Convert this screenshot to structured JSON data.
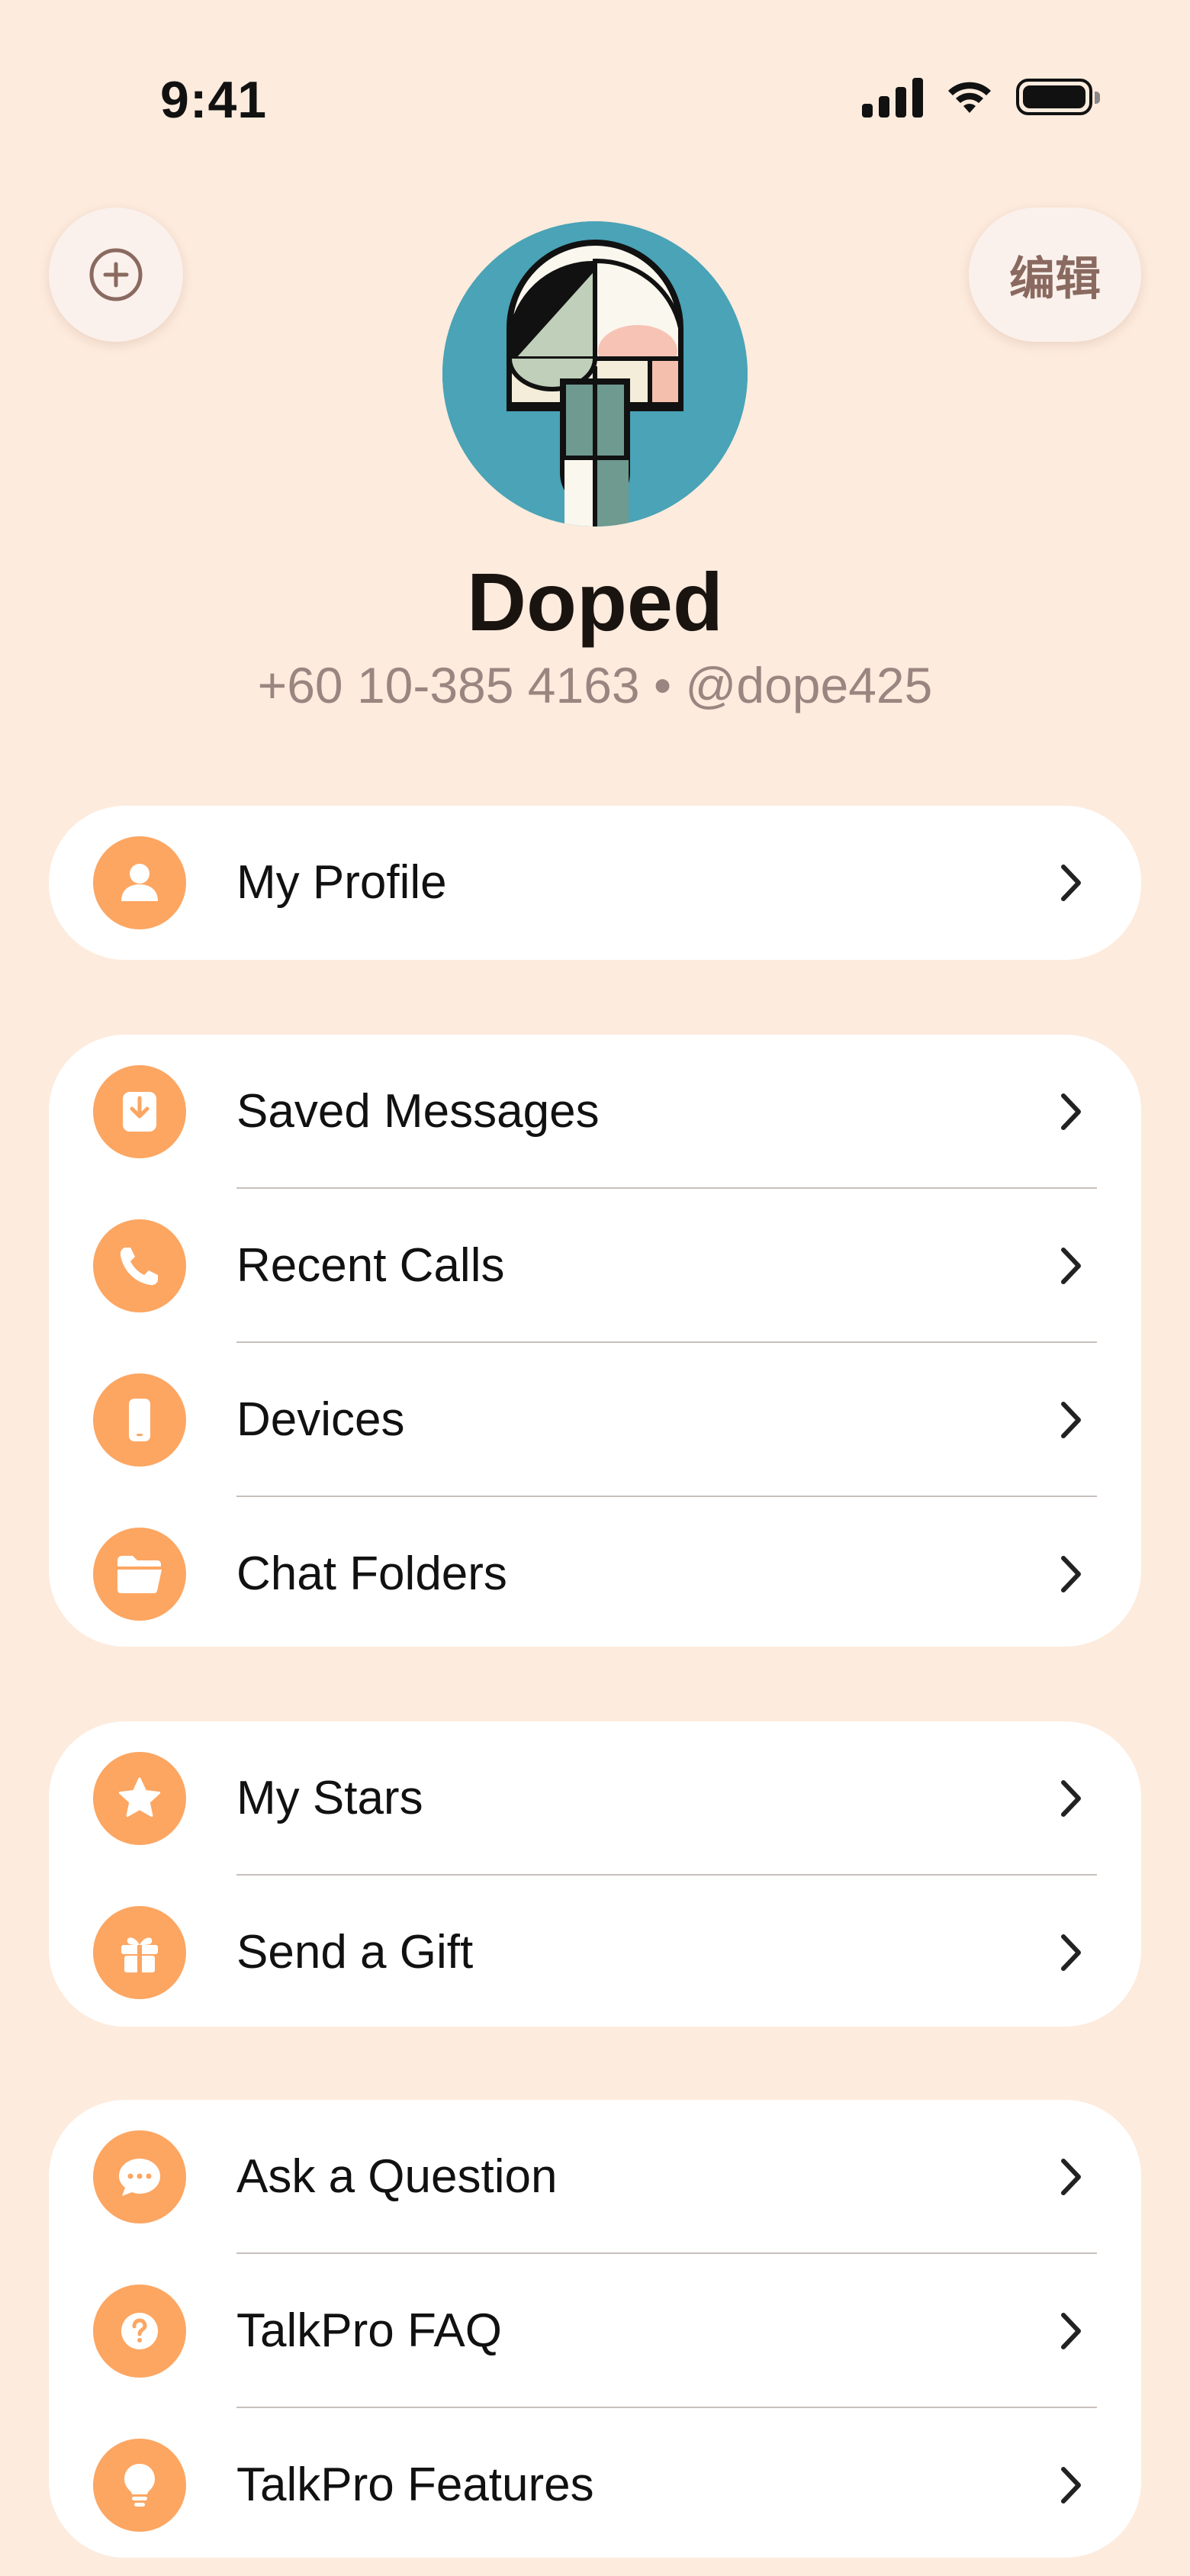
{
  "status_bar": {
    "time": "9:41"
  },
  "header": {
    "edit_label": "编辑",
    "name": "Doped",
    "subtitle": "+60 10-385 4163 • @dope425"
  },
  "colors": {
    "background": "#FDEBDD",
    "icon_accent": "#FCA662",
    "avatar_bg": "#4AA3B6"
  },
  "groups": [
    {
      "items": [
        {
          "label": "My Profile",
          "icon": "person-icon"
        }
      ]
    },
    {
      "items": [
        {
          "label": "Saved Messages",
          "icon": "bookmark-download-icon"
        },
        {
          "label": "Recent Calls",
          "icon": "phone-icon"
        },
        {
          "label": "Devices",
          "icon": "smartphone-icon"
        },
        {
          "label": "Chat Folders",
          "icon": "folder-icon"
        }
      ]
    },
    {
      "items": [
        {
          "label": "My Stars",
          "icon": "star-icon"
        },
        {
          "label": "Send a Gift",
          "icon": "gift-icon"
        }
      ]
    },
    {
      "items": [
        {
          "label": "Ask a Question",
          "icon": "chat-bubble-icon"
        },
        {
          "label": "TalkPro FAQ",
          "icon": "question-icon"
        },
        {
          "label": "TalkPro Features",
          "icon": "lightbulb-icon"
        }
      ]
    }
  ]
}
